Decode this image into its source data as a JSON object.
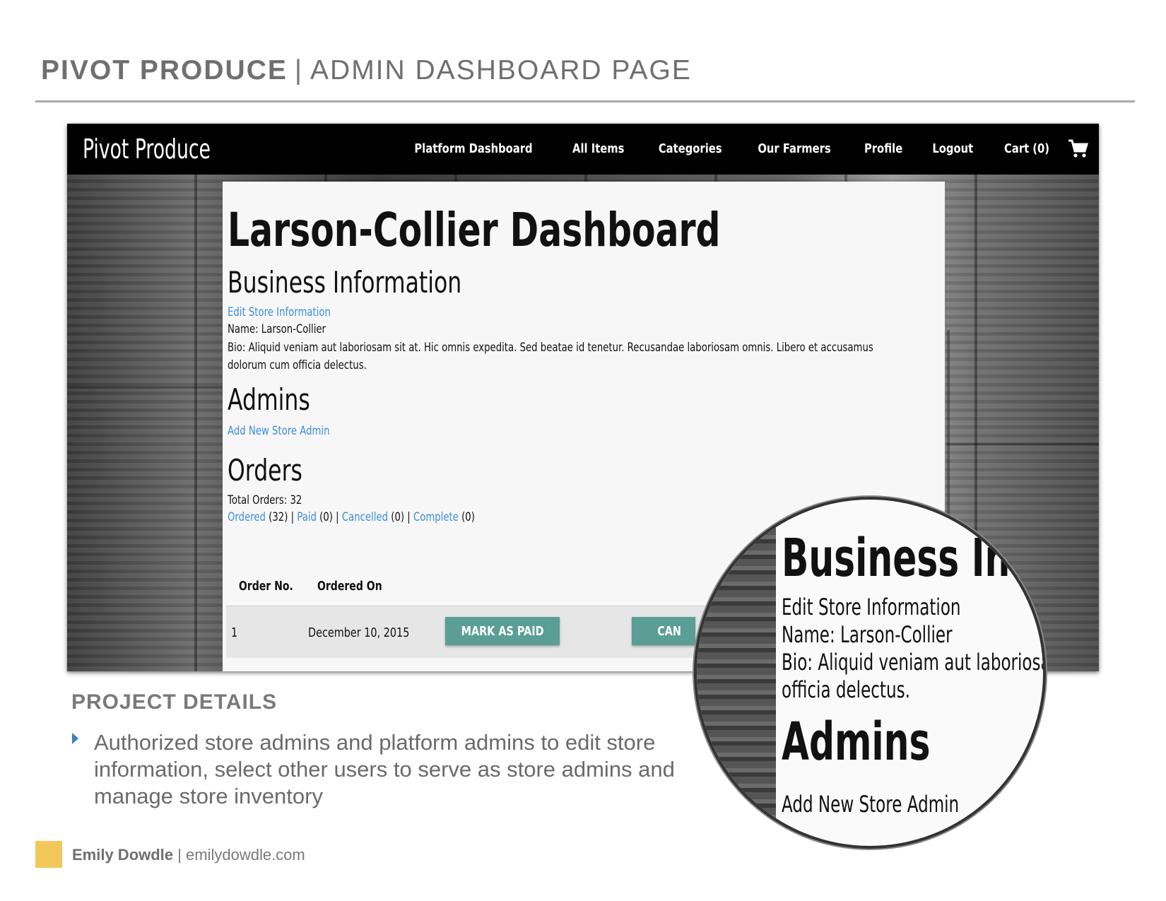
{
  "slide": {
    "title_bold": "PIVOT PRODUCE",
    "title_sep": "|",
    "title_light": "ADMIN DASHBOARD PAGE"
  },
  "app": {
    "brand": "Pivot Produce",
    "nav": [
      "Platform Dashboard",
      "All Items",
      "Categories",
      "Our Farmers",
      "Profile",
      "Logout",
      "Cart (0)"
    ],
    "cart_icon": "shopping-cart-icon"
  },
  "dashboard": {
    "title": "Larson-Collier Dashboard",
    "business_heading": "Business Information",
    "edit_link": "Edit Store Information",
    "name_line": "Name: Larson-Collier",
    "bio_line": "Bio: Aliquid veniam aut laboriosam sit at. Hic omnis expedita. Sed beatae id tenetur. Recusandae laboriosam omnis. Libero et accusamus dolorum cum officia delectus.",
    "admins_heading": "Admins",
    "add_admin_link": "Add New Store Admin",
    "orders_heading": "Orders",
    "total_orders": "Total Orders: 32",
    "filters": [
      {
        "label": "Ordered",
        "count": "(32)"
      },
      {
        "label": "Paid",
        "count": "(0)"
      },
      {
        "label": "Cancelled",
        "count": "(0)"
      },
      {
        "label": "Complete",
        "count": "(0)"
      }
    ],
    "filter_sep": "|",
    "table_headers": [
      "Order No.",
      "Ordered On"
    ],
    "rows": [
      {
        "order_no": "1",
        "ordered_on": "December 10, 2015",
        "primary_action": "MARK AS PAID",
        "secondary_action": "CAN"
      }
    ]
  },
  "magnifier": {
    "heading": "Business Info",
    "edit_link": "Edit Store Information",
    "name_line": "Name: Larson-Collier",
    "bio_line": "Bio: Aliquid veniam aut laboriosam",
    "bio_line2": "officia delectus.",
    "admins_heading": "Admins",
    "add_admin_link": "Add New Store Admin"
  },
  "project": {
    "heading": "PROJECT DETAILS",
    "bullet": "Authorized store admins and platform admins to edit store information, select other users to serve as store admins and manage store inventory"
  },
  "footer": {
    "name": "Emily Dowdle",
    "sep": "|",
    "site": "emilydowdle.com",
    "accent": "#f2c85b"
  },
  "colors": {
    "link": "#3b8edb",
    "button": "#5a9e96",
    "navbar": "#000000"
  }
}
